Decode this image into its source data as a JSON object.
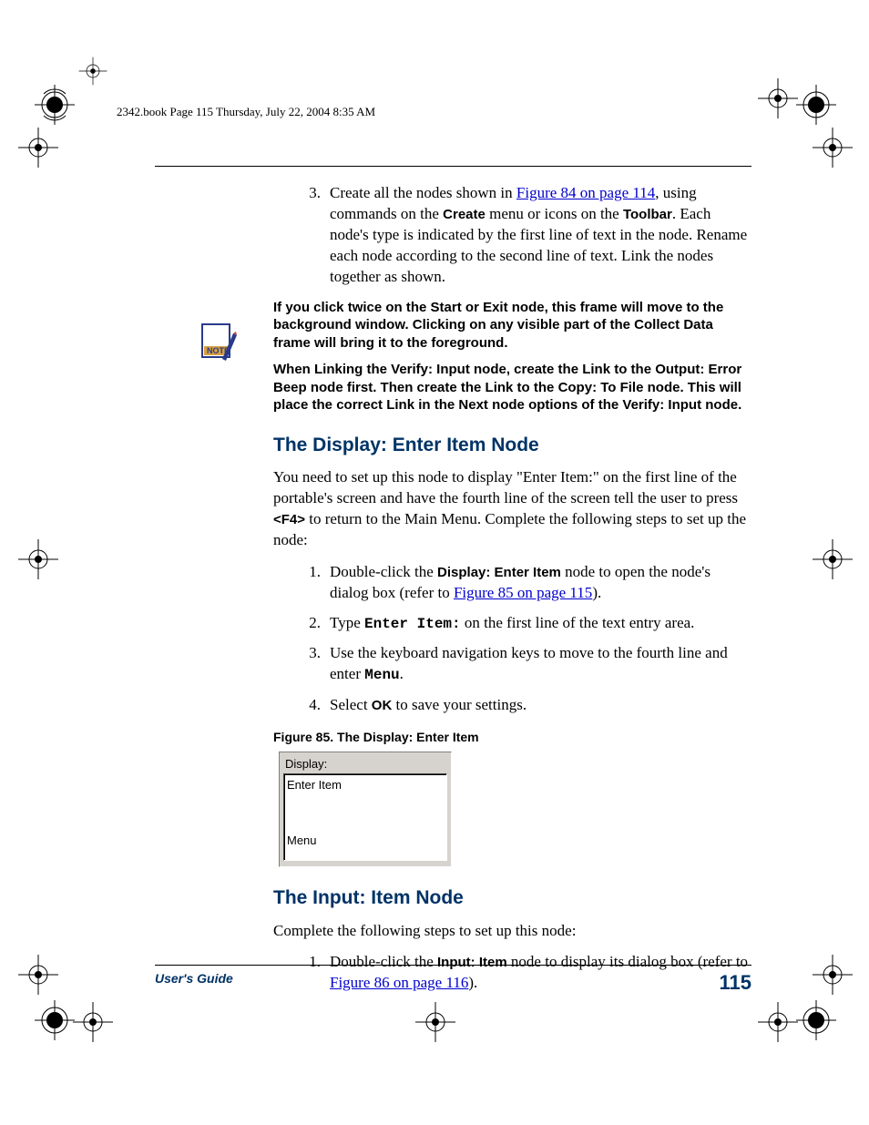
{
  "header": {
    "text": "2342.book  Page 115  Thursday, July 22, 2004  8:35 AM"
  },
  "step3": {
    "num": "3.",
    "pre": "Create all the nodes shown in ",
    "link": "Figure 84 on page 114",
    "post1": ", using commands on the ",
    "create": "Create",
    "post2": " menu or icons on the ",
    "toolbar": "Toolbar",
    "post3": ". Each node's type is indicated by the first line of text in the node. Rename each node according to the second line of text. Link the nodes together as shown."
  },
  "note": {
    "para1_a": "If you click twice on the ",
    "start": "Start",
    "para1_b": " or ",
    "exit": "Exit",
    "para1_c": " node, this frame will move to the background window. Clicking on any visible part of the ",
    "collect": "Collect Data",
    "para1_d": " frame will bring it to the foreground.",
    "para2_a": "When Linking the ",
    "verify": "Verify: Input",
    "para2_b": " node, create the Link to the ",
    "output": "Output: Error Beep",
    "para2_c": " node first. Then create the Link to the ",
    "copy": "Copy: To File",
    "para2_d": " node. This will place the correct Link in the ",
    "next": "Next",
    "para2_e": " node options of the ",
    "verify2": "Verify: Input",
    "para2_f": " node."
  },
  "h2a": "The Display: Enter Item Node",
  "para_a1": "You need to set up this node to display \"Enter Item:\" on the first line of the portable's screen and have the fourth line of the screen tell the user to press ",
  "f4": "<F4>",
  "para_a2": " to return to the Main Menu. Complete the following steps to set up the node:",
  "listA": {
    "i1": {
      "n": "1.",
      "pre": "Double-click the ",
      "b": "Display: Enter Item",
      "mid": " node to open the node's dialog box (refer to ",
      "link": "Figure 85 on page 115",
      "post": ")."
    },
    "i2": {
      "n": "2.",
      "pre": "Type ",
      "mono": "Enter Item:",
      "post": " on the first line of the text entry area."
    },
    "i3": {
      "n": "3.",
      "pre": "Use the keyboard navigation keys to move to the fourth line and enter ",
      "mono": "Menu",
      "post": "."
    },
    "i4": {
      "n": "4.",
      "pre": "Select ",
      "b": "OK",
      "post": " to save your settings."
    }
  },
  "figcap": "Figure 85. The Display: Enter Item",
  "fig": {
    "label": "Display:",
    "content": "Enter Item\n\n\nMenu"
  },
  "h2b": "The Input: Item Node",
  "para_b": "Complete the following steps to set up this node:",
  "listB": {
    "i1": {
      "n": "1.",
      "pre": "Double-click the ",
      "b": "Input: Item",
      "mid": " node to display its dialog box (refer to ",
      "link": "Figure 86 on page 116",
      "post": ")."
    }
  },
  "footer": {
    "left": "User's Guide",
    "right": "115"
  }
}
